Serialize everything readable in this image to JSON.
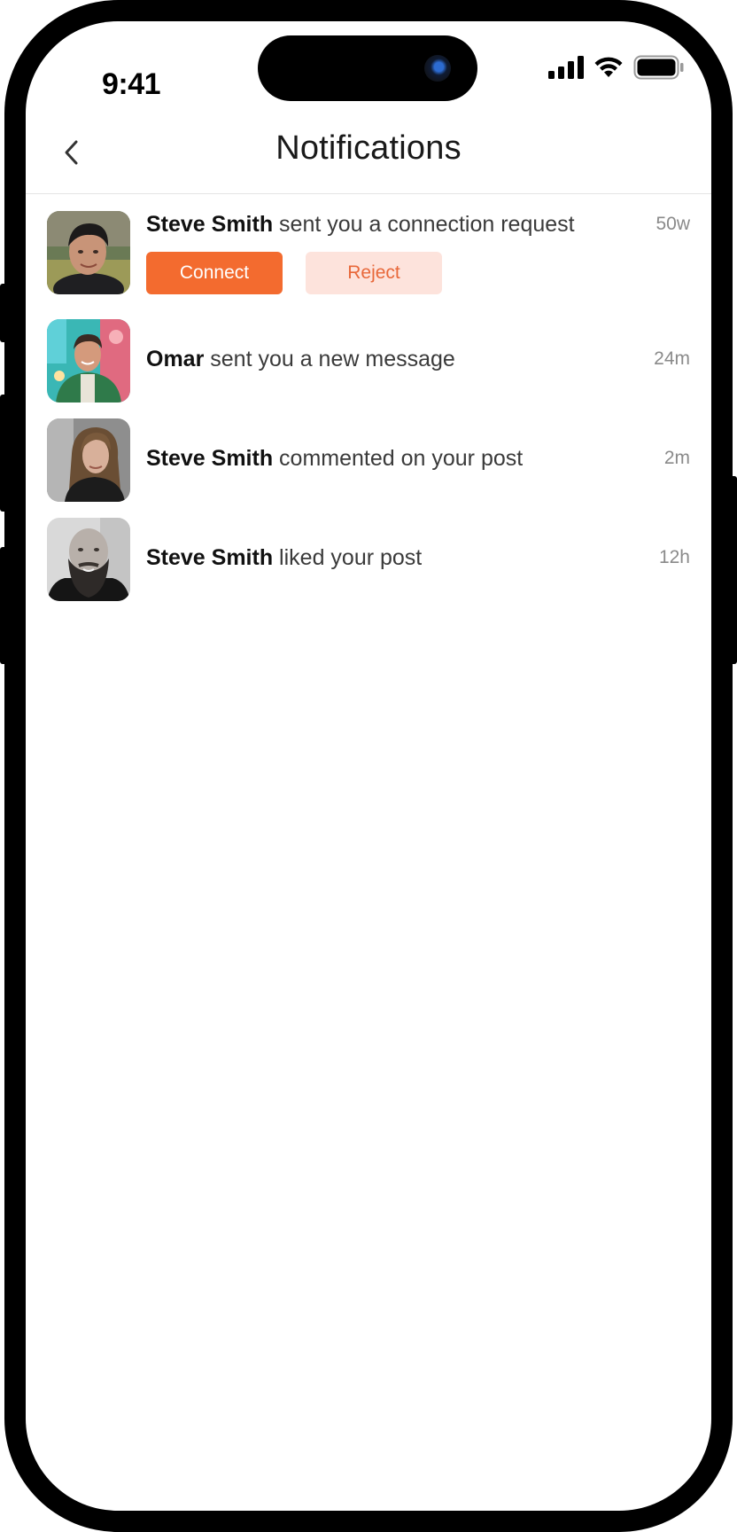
{
  "status_bar": {
    "time": "9:41",
    "icons": [
      "signal-icon",
      "wifi-icon",
      "battery-icon"
    ]
  },
  "header": {
    "title": "Notifications",
    "back_icon": "chevron-left-icon"
  },
  "colors": {
    "accent": "#f36b2f",
    "accent_soft": "#fde3dc",
    "text_primary": "#111111",
    "text_secondary": "#3a3a3a",
    "text_muted": "#8a8a8a"
  },
  "notifications": [
    {
      "name": "Steve Smith",
      "text": " sent you a connection request",
      "time": "50w",
      "actions": {
        "connect_label": "Connect",
        "reject_label": "Reject"
      }
    },
    {
      "name": "Omar",
      "text": " sent you a new message",
      "time": "24m"
    },
    {
      "name": "Steve Smith",
      "text": " commented on your post",
      "time": "2m"
    },
    {
      "name": "Steve Smith",
      "text": " liked your post",
      "time": "12h"
    }
  ]
}
